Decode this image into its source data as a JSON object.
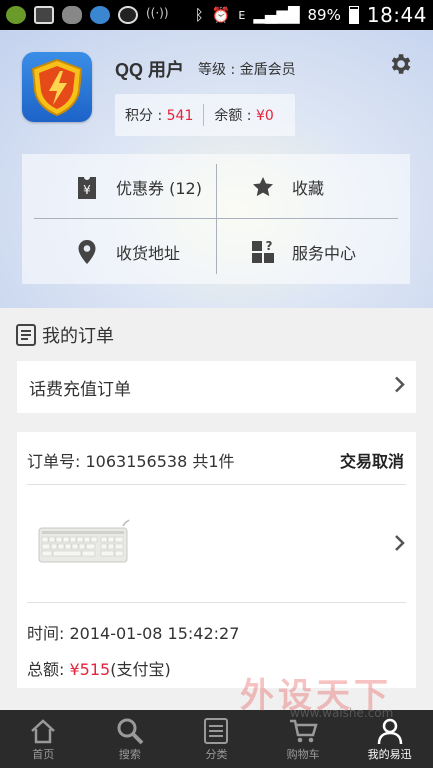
{
  "status_bar": {
    "battery": "89%",
    "time": "18:44"
  },
  "profile": {
    "name": "QQ 用户",
    "level": "等级 : 金盾会员",
    "points_label": "积分 : ",
    "points_value": "541",
    "balance_label": "余额 : ",
    "balance_value": "¥0"
  },
  "shortcuts": {
    "coupons": "优惠券 (12)",
    "favorites": "收藏",
    "address": "收货地址",
    "service": "服务中心"
  },
  "orders": {
    "title": "我的订单",
    "recharge": "话费充值订单",
    "order_no": "订单号: 1063156538 共1件",
    "status": "交易取消",
    "time": "时间: 2014-01-08 15:42:27",
    "total_label": "总额: ",
    "total_value": "¥515",
    "total_method": "(支付宝)"
  },
  "watermark": {
    "big": "外设天下",
    "small": "www.waishe.com"
  },
  "nav": {
    "home": "首页",
    "search": "搜索",
    "category": "分类",
    "cart": "购物车",
    "mine": "我的易迅"
  }
}
